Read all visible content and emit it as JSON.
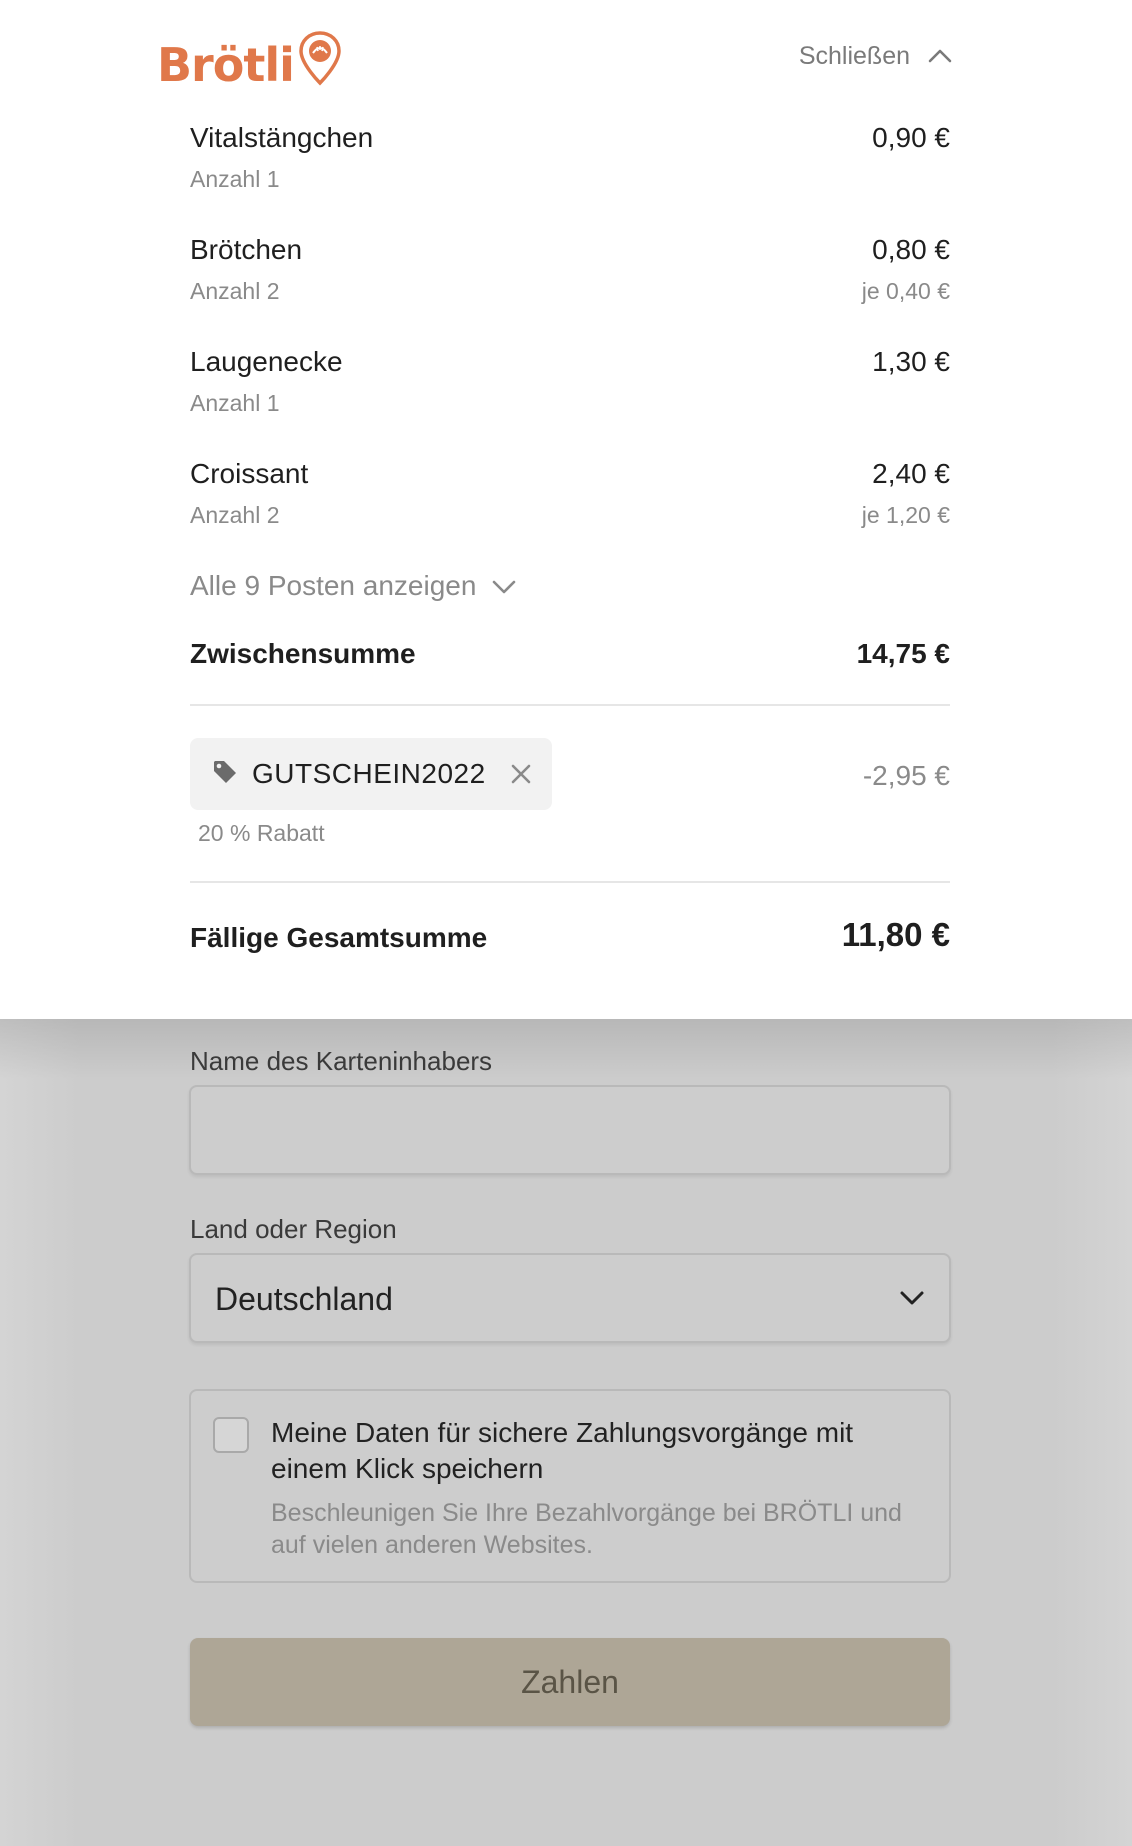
{
  "brand": {
    "name": "Brötli",
    "accent_color": "#e0784a"
  },
  "header": {
    "close_label": "Schließen"
  },
  "items": [
    {
      "name": "Vitalstängchen",
      "qty": "Anzahl 1",
      "price": "0,90 €",
      "unit_price": ""
    },
    {
      "name": "Brötchen",
      "qty": "Anzahl 2",
      "price": "0,80 €",
      "unit_price": "je 0,40 €"
    },
    {
      "name": "Laugenecke",
      "qty": "Anzahl 1",
      "price": "1,30 €",
      "unit_price": ""
    },
    {
      "name": "Croissant",
      "qty": "Anzahl 2",
      "price": "2,40 €",
      "unit_price": "je 1,20 €"
    }
  ],
  "show_all_label": "Alle 9 Posten anzeigen",
  "subtotal": {
    "label": "Zwischensumme",
    "value": "14,75 €"
  },
  "coupon": {
    "code": "GUTSCHEIN2022",
    "discount": "-2,95 €",
    "description": "20 % Rabatt"
  },
  "total": {
    "label": "Fällige Gesamtsumme",
    "value": "11,80 €"
  },
  "form": {
    "cardholder_label": "Name des Karteninhabers",
    "cardholder_value": "",
    "country_label": "Land oder Region",
    "country_value": "Deutschland",
    "save_title": "Meine Daten für sichere Zahlungsvorgänge mit einem Klick speichern",
    "save_desc": "Beschleunigen Sie Ihre Bezahlvorgänge bei BRÖTLI und auf vielen anderen Websites.",
    "save_checked": false,
    "pay_label": "Zahlen",
    "pay_color": "#aea696"
  }
}
